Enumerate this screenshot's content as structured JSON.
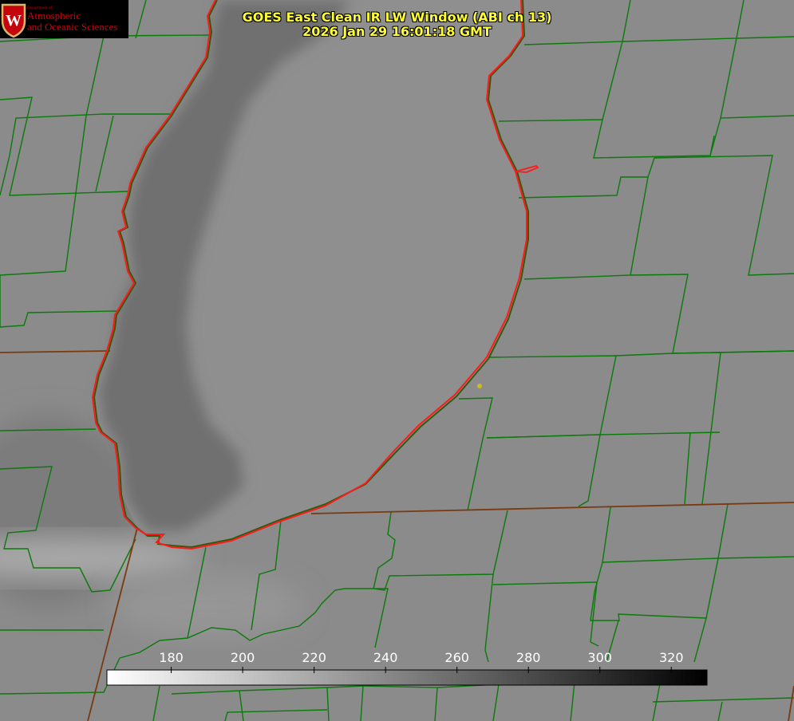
{
  "header": {
    "title_line1": "GOES East Clean IR LW Window (ABI ch 13)",
    "title_line2": "2026 Jan 29 16:01:18 GMT"
  },
  "logo": {
    "dept_line": "Department of",
    "line1": "Atmospheric",
    "line2": "and Oceanic Sciences",
    "crest_letter": "W",
    "icon": "uw-crest-icon"
  },
  "colorbar": {
    "min_value": 162,
    "max_value": 330,
    "gradient": [
      "#ffffff",
      "#000000"
    ],
    "tick_values": [
      180,
      200,
      220,
      240,
      260,
      280,
      300,
      320
    ],
    "tick_labels": [
      "180",
      "200",
      "220",
      "240",
      "260",
      "280",
      "300",
      "320"
    ]
  },
  "colors": {
    "background_gray": "#8a8a8a",
    "lake_gray": "#8e8e8e",
    "plume_gray": "#727272",
    "county_lines": "#0a7a0a",
    "state_lines": "#7a3a10",
    "shoreline": "#ff1a1a",
    "title_text": "#ffff33",
    "marker": "#ccbb22"
  }
}
